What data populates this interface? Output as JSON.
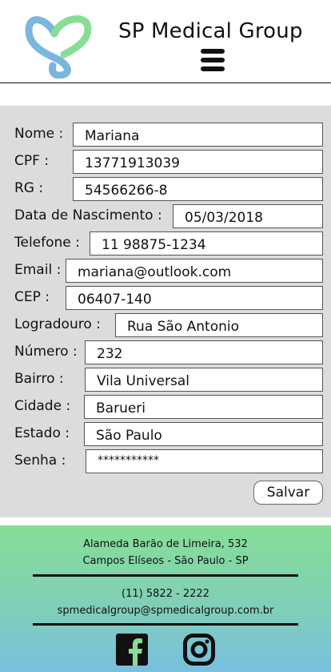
{
  "header": {
    "brand": "SP Medical Group",
    "logo_icon": "heart-sp-logo",
    "menu_icon": "hamburger-menu-icon",
    "logo_colors": {
      "blue": "#7bb6dd",
      "green": "#86de96"
    }
  },
  "form": {
    "fields": [
      {
        "label": "Nome :",
        "value": "Mariana"
      },
      {
        "label": "CPF :",
        "value": "13771913039"
      },
      {
        "label": "RG :",
        "value": "54566266-8"
      },
      {
        "label": "Data de Nascimento :",
        "value": "05/03/2018"
      },
      {
        "label": "Telefone :",
        "value": "11 98875-1234"
      },
      {
        "label": "Email :",
        "value": "mariana@outlook.com"
      },
      {
        "label": "CEP  :",
        "value": "06407-140"
      },
      {
        "label": "Logradouro :",
        "value": "Rua São Antonio"
      },
      {
        "label": "Número :",
        "value": "232"
      },
      {
        "label": "Bairro :",
        "value": "Vila Universal"
      },
      {
        "label": "Cidade :",
        "value": "Barueri"
      },
      {
        "label": "Estado :",
        "value": "São Paulo"
      },
      {
        "label": "Senha :",
        "value": "***********"
      }
    ],
    "save_label": "Salvar",
    "background": "#dcdcdc"
  },
  "footer": {
    "address_line1": "Alameda Barão de Limeira, 532",
    "address_line2": "Campos Elíseos - São Paulo - SP",
    "phone": "(11) 5822 - 2222",
    "email": "spmedicalgroup@spmedicalgroup.com.br",
    "social_icons": [
      "facebook-icon",
      "instagram-icon"
    ],
    "gradient": [
      "#86de96",
      "#79bfe0"
    ]
  }
}
